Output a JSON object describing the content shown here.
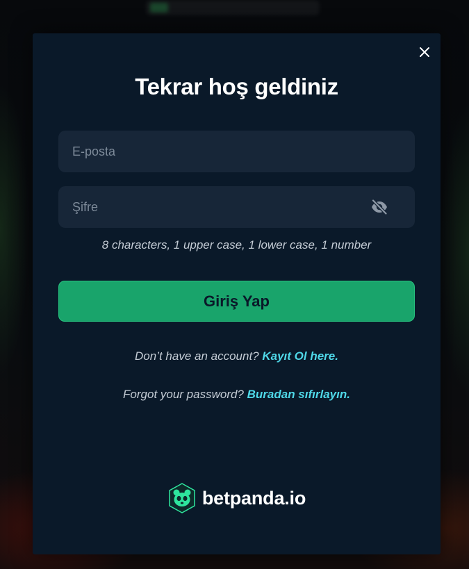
{
  "modal": {
    "title": "Tekrar hoş geldiniz",
    "email": {
      "value": "",
      "placeholder": "E-posta"
    },
    "password": {
      "value": "",
      "placeholder": "Şifre",
      "toggle_icon": "eye-off-icon"
    },
    "password_hint": "8 characters, 1 upper case, 1 lower case, 1 number",
    "submit_label": "Giriş Yap",
    "signup": {
      "prefix": "Don’t have an account? ",
      "link": "Kayıt Ol here."
    },
    "forgot": {
      "prefix": "Forgot your password? ",
      "link": "Buradan sıfırlayın."
    },
    "close_icon": "close-icon"
  },
  "brand": {
    "name": "betpanda.io",
    "logo_icon": "panda-logo-icon"
  },
  "colors": {
    "modal_bg": "#0a1929",
    "field_bg": "#172638",
    "accent_green": "#19a46b",
    "link_cyan": "#4fd8e8",
    "logo_green": "#2ee59d"
  }
}
